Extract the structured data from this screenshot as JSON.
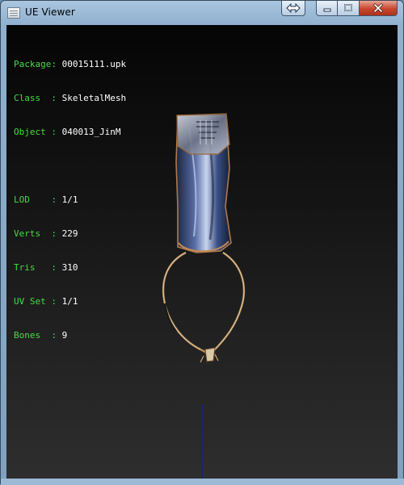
{
  "window": {
    "title": "UE Viewer"
  },
  "info": {
    "package_label": "Package:",
    "package_value": "00015111.upk",
    "class_label": "Class  :",
    "class_value": "SkeletalMesh",
    "object_label": "Object :",
    "object_value": "040013_JinM",
    "lod_label": "LOD    :",
    "lod_value": "1/1",
    "verts_label": "Verts  :",
    "verts_value": "229",
    "tris_label": "Tris   :",
    "tris_value": "310",
    "uvset_label": "UV Set :",
    "uvset_value": "1/1",
    "bones_label": "Bones  :",
    "bones_value": "9"
  },
  "colors": {
    "info_key": "#3fe03f",
    "info_value": "#ffffff",
    "axis_line": "#1a1aa0"
  },
  "icons": [
    "app-icon",
    "swap-arrows-icon",
    "minimize-icon",
    "maximize-icon",
    "close-icon"
  ]
}
